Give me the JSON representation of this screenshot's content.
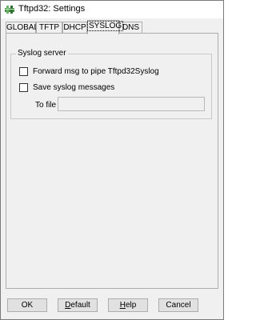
{
  "window": {
    "title": "Tftpd32: Settings"
  },
  "tabs": [
    {
      "label": "GLOBAL",
      "active": false
    },
    {
      "label": "TFTP",
      "active": false
    },
    {
      "label": "DHCP",
      "active": false
    },
    {
      "label": "SYSLOG",
      "active": true
    },
    {
      "label": "DNS",
      "active": false
    }
  ],
  "syslog": {
    "group_label": "Syslog server",
    "forward_label": "Forward msg to pipe Tftpd32Syslog",
    "forward_checked": false,
    "save_label": "Save syslog messages",
    "save_checked": false,
    "tofile_label": "To file",
    "tofile_value": ""
  },
  "buttons": {
    "ok": "OK",
    "default": "Default",
    "help": "Help",
    "cancel": "Cancel"
  },
  "icons": {
    "app": "tftpd32-app-icon"
  }
}
